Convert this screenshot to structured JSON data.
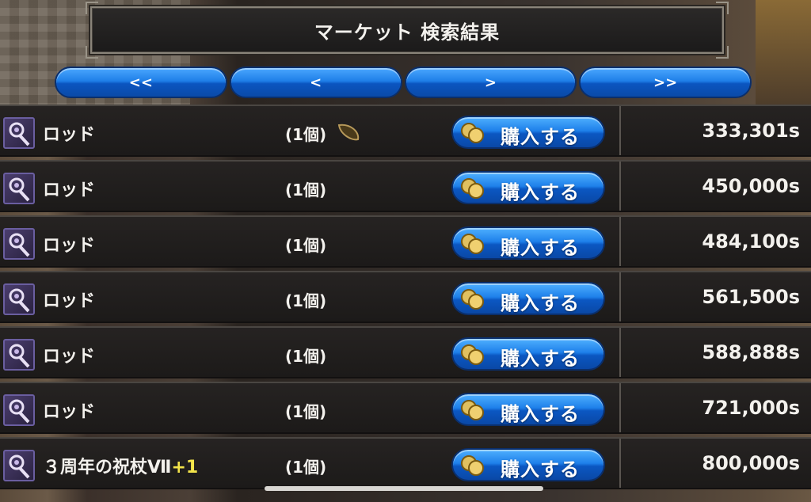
{
  "header": {
    "title": "マーケット 検索結果"
  },
  "pager": {
    "first_label": "<<",
    "prev_label": "<",
    "next_label": ">",
    "last_label": ">>"
  },
  "buy_label": "購入する",
  "colors": {
    "button_blue": "#1e80ea",
    "row_bg": "#1f1c1b",
    "text": "#f3f1ed",
    "enhance_yellow": "#f3e44a"
  },
  "listings": [
    {
      "name": "ロッド",
      "enhance": "",
      "quantity": "(1個)",
      "price": "333,301s",
      "icon": "rod-icon",
      "has_seed_icon": true
    },
    {
      "name": "ロッド",
      "enhance": "",
      "quantity": "(1個)",
      "price": "450,000s",
      "icon": "rod-icon"
    },
    {
      "name": "ロッド",
      "enhance": "",
      "quantity": "(1個)",
      "price": "484,100s",
      "icon": "rod-icon"
    },
    {
      "name": "ロッド",
      "enhance": "",
      "quantity": "(1個)",
      "price": "561,500s",
      "icon": "rod-icon"
    },
    {
      "name": "ロッド",
      "enhance": "",
      "quantity": "(1個)",
      "price": "588,888s",
      "icon": "rod-icon"
    },
    {
      "name": "ロッド",
      "enhance": "",
      "quantity": "(1個)",
      "price": "721,000s",
      "icon": "rod-icon"
    },
    {
      "name": "３周年の祝杖Ⅶ",
      "enhance": "+1",
      "quantity": "(1個)",
      "price": "800,000s",
      "icon": "rod-icon"
    }
  ]
}
